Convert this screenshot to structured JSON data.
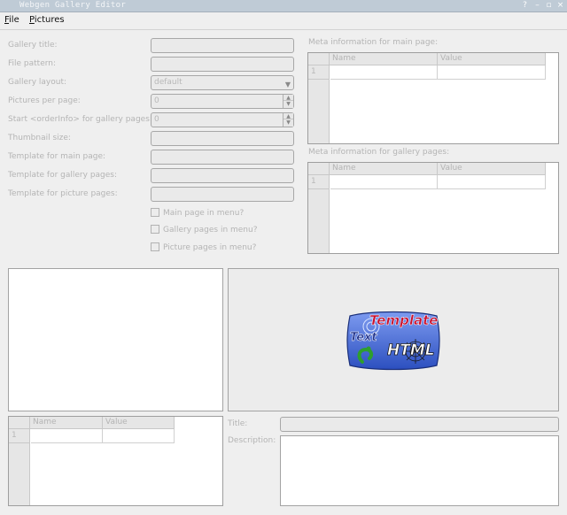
{
  "window": {
    "title": "Webgen Gallery Editor",
    "buttons": [
      "?",
      "–",
      "▫",
      "×"
    ]
  },
  "menu": [
    {
      "mnemonic": "F",
      "rest": "ile"
    },
    {
      "mnemonic": "P",
      "rest": "ictures"
    }
  ],
  "form": {
    "gallery_title": {
      "label": "Gallery title:",
      "value": ""
    },
    "file_pattern": {
      "label": "File pattern:",
      "value": ""
    },
    "gallery_layout": {
      "label": "Gallery layout:",
      "value": "default"
    },
    "pictures_per_page": {
      "label": "Pictures per page:",
      "value": "0"
    },
    "start_orderinfo": {
      "label": "Start <orderInfo> for gallery pages:",
      "value": "0"
    },
    "thumbnail_size": {
      "label": "Thumbnail size:",
      "value": ""
    },
    "template_main": {
      "label": "Template for main page:",
      "value": ""
    },
    "template_gallery": {
      "label": "Template for gallery pages:",
      "value": ""
    },
    "template_picture": {
      "label": "Template for picture pages:",
      "value": ""
    },
    "checks": {
      "main_in_menu": "Main page in menu?",
      "gallery_in_menu": "Gallery pages in menu?",
      "picture_in_menu": "Picture pages in menu?"
    }
  },
  "meta_main": {
    "label": "Meta information for main page:",
    "columns": [
      "Name",
      "Value"
    ],
    "rows": [
      "1"
    ]
  },
  "meta_gallery": {
    "label": "Meta information for gallery pages:",
    "columns": [
      "Name",
      "Value"
    ],
    "rows": [
      "1"
    ]
  },
  "picture_meta": {
    "columns": [
      "Name",
      "Value"
    ],
    "rows": [
      "1"
    ]
  },
  "logo": {
    "text_template": "Template",
    "text_text": "Text",
    "text_html": "HTML"
  },
  "picture_info": {
    "title_label": "Title:",
    "description_label": "Description:"
  },
  "colors": {
    "titlebar": "#bfcbd6",
    "background": "#efefef",
    "logo_blue": "#4a6fd8",
    "logo_red": "#c8102e"
  }
}
